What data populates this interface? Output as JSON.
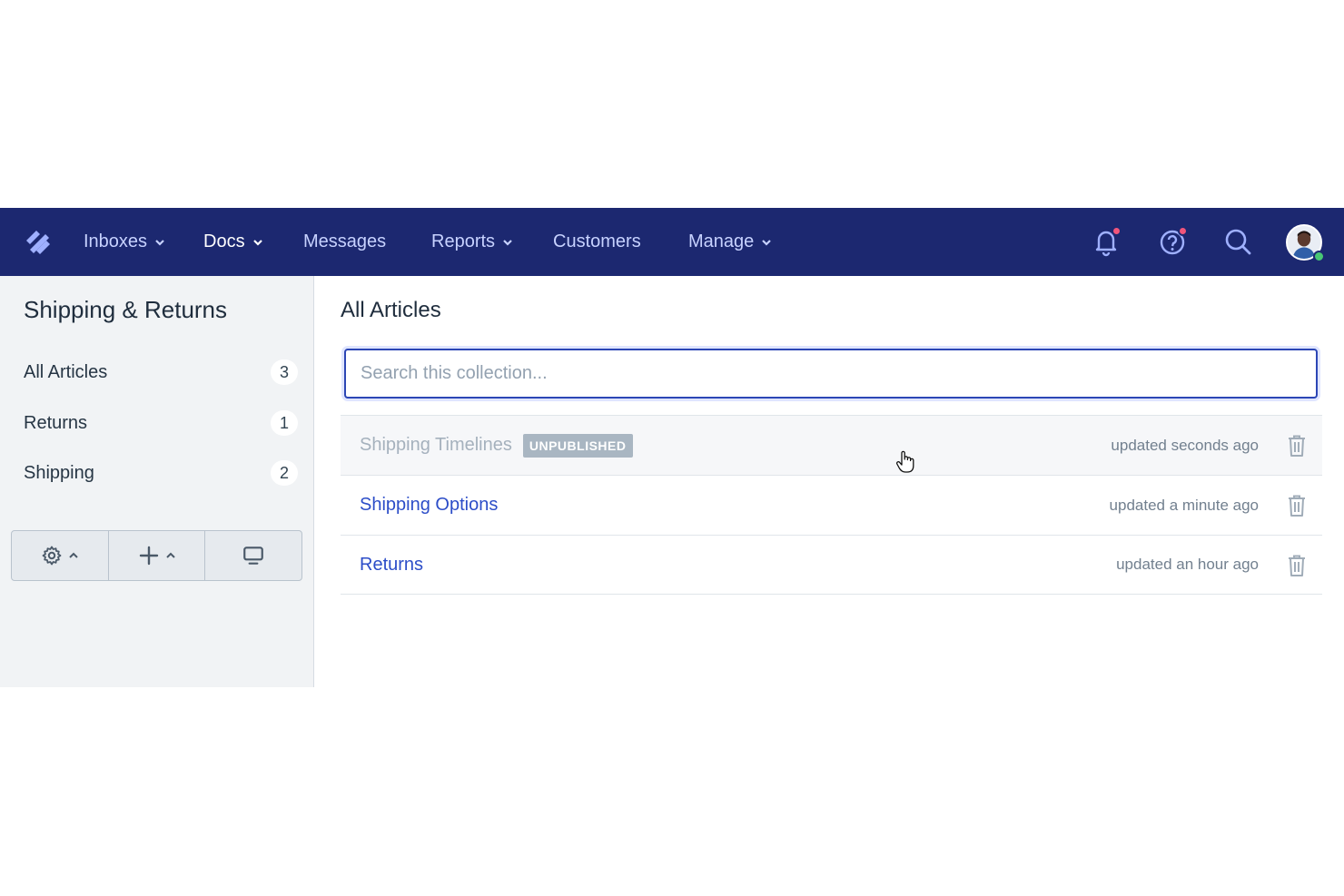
{
  "nav": {
    "items": [
      {
        "label": "Inboxes",
        "has_dropdown": true,
        "active": false
      },
      {
        "label": "Docs",
        "has_dropdown": true,
        "active": true
      },
      {
        "label": "Messages",
        "has_dropdown": false,
        "active": false
      },
      {
        "label": "Reports",
        "has_dropdown": true,
        "active": false
      },
      {
        "label": "Customers",
        "has_dropdown": false,
        "active": false
      },
      {
        "label": "Manage",
        "has_dropdown": true,
        "active": false
      }
    ],
    "icons": [
      "bell-icon",
      "help-icon",
      "search-icon"
    ],
    "colors": {
      "background": "#1c2870",
      "notification_dot": "#f0557b",
      "online": "#48c774"
    }
  },
  "sidebar": {
    "title": "Shipping & Returns",
    "items": [
      {
        "label": "All Articles",
        "count": "3"
      },
      {
        "label": "Returns",
        "count": "1"
      },
      {
        "label": "Shipping",
        "count": "2"
      }
    ],
    "toolbar": [
      "settings-icon",
      "add-icon",
      "preview-icon"
    ]
  },
  "main": {
    "title": "All Articles",
    "search_placeholder": "Search this collection...",
    "articles": [
      {
        "title": "Shipping Timelines",
        "badge": "UNPUBLISHED",
        "updated": "updated seconds ago"
      },
      {
        "title": "Shipping Options",
        "badge": "",
        "updated": "updated a minute ago"
      },
      {
        "title": "Returns",
        "badge": "",
        "updated": "updated an hour ago"
      }
    ],
    "colors": {
      "link": "#2c4dc8",
      "search_border": "#2c46b5"
    }
  }
}
